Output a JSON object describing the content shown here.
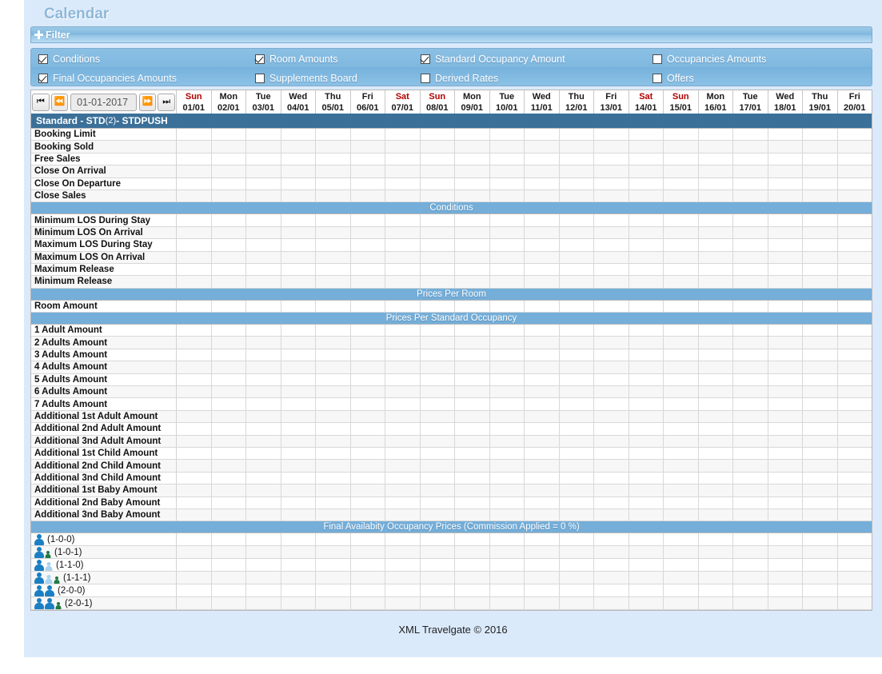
{
  "app": {
    "title": "Calendar",
    "footer": "XML Travelgate © 2016"
  },
  "filter": {
    "label": "Filter",
    "expand_icon": "plus-icon",
    "checkboxes": [
      [
        {
          "label": "Conditions",
          "checked": true
        },
        {
          "label": "Room Amounts",
          "checked": true
        },
        {
          "label": "Standard Occupancy Amount",
          "checked": true
        },
        {
          "label": "Occupancies Amounts",
          "checked": false
        }
      ],
      [
        {
          "label": "Final Occupancies Amounts",
          "checked": true
        },
        {
          "label": "Supplements Board",
          "checked": false
        },
        {
          "label": "Derived Rates",
          "checked": false
        },
        {
          "label": "Offers",
          "checked": false
        }
      ]
    ]
  },
  "datenav": {
    "first_icon": "skip-to-start-icon",
    "prev_icon": "fast-rewind-icon",
    "value": "01-01-2017",
    "placeholder": "dd-mm-yyyy",
    "next_icon": "fast-forward-icon",
    "last_icon": "skip-to-end-icon"
  },
  "columns": [
    {
      "dow": "Sun",
      "date": "01/01",
      "weekend": true
    },
    {
      "dow": "Mon",
      "date": "02/01",
      "weekend": false
    },
    {
      "dow": "Tue",
      "date": "03/01",
      "weekend": false
    },
    {
      "dow": "Wed",
      "date": "04/01",
      "weekend": false
    },
    {
      "dow": "Thu",
      "date": "05/01",
      "weekend": false
    },
    {
      "dow": "Fri",
      "date": "06/01",
      "weekend": false
    },
    {
      "dow": "Sat",
      "date": "07/01",
      "weekend": true
    },
    {
      "dow": "Sun",
      "date": "08/01",
      "weekend": true
    },
    {
      "dow": "Mon",
      "date": "09/01",
      "weekend": false
    },
    {
      "dow": "Tue",
      "date": "10/01",
      "weekend": false
    },
    {
      "dow": "Wed",
      "date": "11/01",
      "weekend": false
    },
    {
      "dow": "Thu",
      "date": "12/01",
      "weekend": false
    },
    {
      "dow": "Fri",
      "date": "13/01",
      "weekend": false
    },
    {
      "dow": "Sat",
      "date": "14/01",
      "weekend": true
    },
    {
      "dow": "Sun",
      "date": "15/01",
      "weekend": true
    },
    {
      "dow": "Mon",
      "date": "16/01",
      "weekend": false
    },
    {
      "dow": "Tue",
      "date": "17/01",
      "weekend": false
    },
    {
      "dow": "Wed",
      "date": "18/01",
      "weekend": false
    },
    {
      "dow": "Thu",
      "date": "19/01",
      "weekend": false
    },
    {
      "dow": "Fri",
      "date": "20/01",
      "weekend": false
    }
  ],
  "room_header": {
    "name": "Standard",
    "code": "STD",
    "count": "(2)",
    "rate": "STDPUSH",
    "full": "Standard - STD (2) - STDPUSH"
  },
  "sections": [
    {
      "band": null,
      "rows": [
        "Booking Limit",
        "Booking Sold",
        "Free Sales",
        "Close On Arrival",
        "Close On Departure",
        "Close Sales"
      ]
    },
    {
      "band": "Conditions",
      "rows": [
        "Minimum LOS During Stay",
        "Minimum LOS On Arrival",
        "Maximum LOS During Stay",
        "Maximum LOS On Arrival",
        "Maximum Release",
        "Minimum Release"
      ]
    },
    {
      "band": "Prices Per Room",
      "rows": [
        "Room Amount"
      ]
    },
    {
      "band": "Prices Per Standard Occupancy",
      "rows": [
        "1 Adult Amount",
        "2 Adults Amount",
        "3 Adults Amount",
        "4 Adults Amount",
        "5 Adults Amount",
        "6 Adults Amount",
        "7 Adults Amount",
        "Additional 1st Adult Amount",
        "Additional 2nd Adult Amount",
        "Additional 3nd Adult Amount",
        "Additional 1st Child Amount",
        "Additional 2nd Child Amount",
        "Additional 3nd Child Amount",
        "Additional 1st Baby Amount",
        "Additional 2nd Baby Amount",
        "Additional 3nd Baby Amount"
      ]
    }
  ],
  "final_section": {
    "band": "Final Availabity Occupancy Prices (Commission Applied = 0 %)",
    "rows": [
      {
        "label": "(1-0-0)",
        "adults": 1,
        "children": 0,
        "babies": 0
      },
      {
        "label": "(1-0-1)",
        "adults": 1,
        "children": 0,
        "babies": 1
      },
      {
        "label": "(1-1-0)",
        "adults": 1,
        "children": 1,
        "babies": 0
      },
      {
        "label": "(1-1-1)",
        "adults": 1,
        "children": 1,
        "babies": 1
      },
      {
        "label": "(2-0-0)",
        "adults": 2,
        "children": 0,
        "babies": 0
      },
      {
        "label": "(2-0-1)",
        "adults": 2,
        "children": 0,
        "babies": 1
      }
    ]
  },
  "colors": {
    "page_bg": "#dbeafb",
    "band_dark": "#3b7099",
    "band_light": "#74aed9",
    "filter_bar": "#7eb6dd",
    "weekend_text": "#b20000",
    "title": "#8fb8d8"
  }
}
